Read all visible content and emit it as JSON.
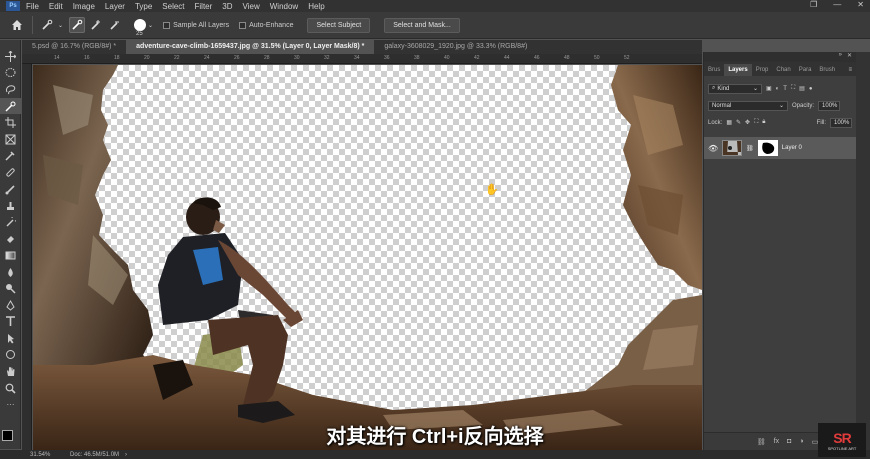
{
  "menu": {
    "logo": "Ps",
    "items": [
      "File",
      "Edit",
      "Image",
      "Layer",
      "Type",
      "Select",
      "Filter",
      "3D",
      "View",
      "Window",
      "Help"
    ]
  },
  "options": {
    "brush_size": "25",
    "sample_all_layers": "Sample All Layers",
    "auto_enhance": "Auto-Enhance",
    "select_subject": "Select Subject",
    "select_and_mask": "Select and Mask..."
  },
  "tabs": [
    {
      "label": "5.psd @ 16.7% (RGB/8#) *",
      "active": false
    },
    {
      "label": "adventure-cave-climb-1659437.jpg @ 31.5% (Layer 0, Layer Mask/8) *",
      "active": true
    },
    {
      "label": "galaxy-3608029_1920.jpg @ 33.3% (RGB/8#)",
      "active": false
    }
  ],
  "ruler_ticks": [
    "14",
    "16",
    "18",
    "20",
    "22",
    "24",
    "26",
    "28",
    "30",
    "32",
    "34",
    "36",
    "38",
    "40",
    "42",
    "44",
    "46",
    "48",
    "50",
    "52"
  ],
  "layers_panel": {
    "tabs": [
      "Brus",
      "Layers",
      "Prop",
      "Chan",
      "Para",
      "Brush"
    ],
    "active_tab": "Layers",
    "filter": "Kind",
    "blend_mode": "Normal",
    "opacity_label": "Opacity:",
    "opacity_value": "100%",
    "lock_label": "Lock:",
    "fill_label": "Fill:",
    "fill_value": "100%",
    "layer_name": "Layer 0",
    "bottom_icons": [
      "link-icon",
      "fx-icon",
      "mask-icon",
      "adjustment-icon",
      "folder-icon",
      "new-layer-icon",
      "trash-icon"
    ],
    "fx_label": "fx"
  },
  "status": {
    "zoom": "31.54%",
    "doc": "Doc: 46.5M/51.0M"
  },
  "subtitle": "对其进行 Ctrl+i反向选择",
  "watermark": {
    "mark": "SR",
    "text": "SPOTLINE ART"
  },
  "colors": {
    "foreground": "#000000",
    "background": "#ffffff",
    "accent": "#e23b3b"
  }
}
